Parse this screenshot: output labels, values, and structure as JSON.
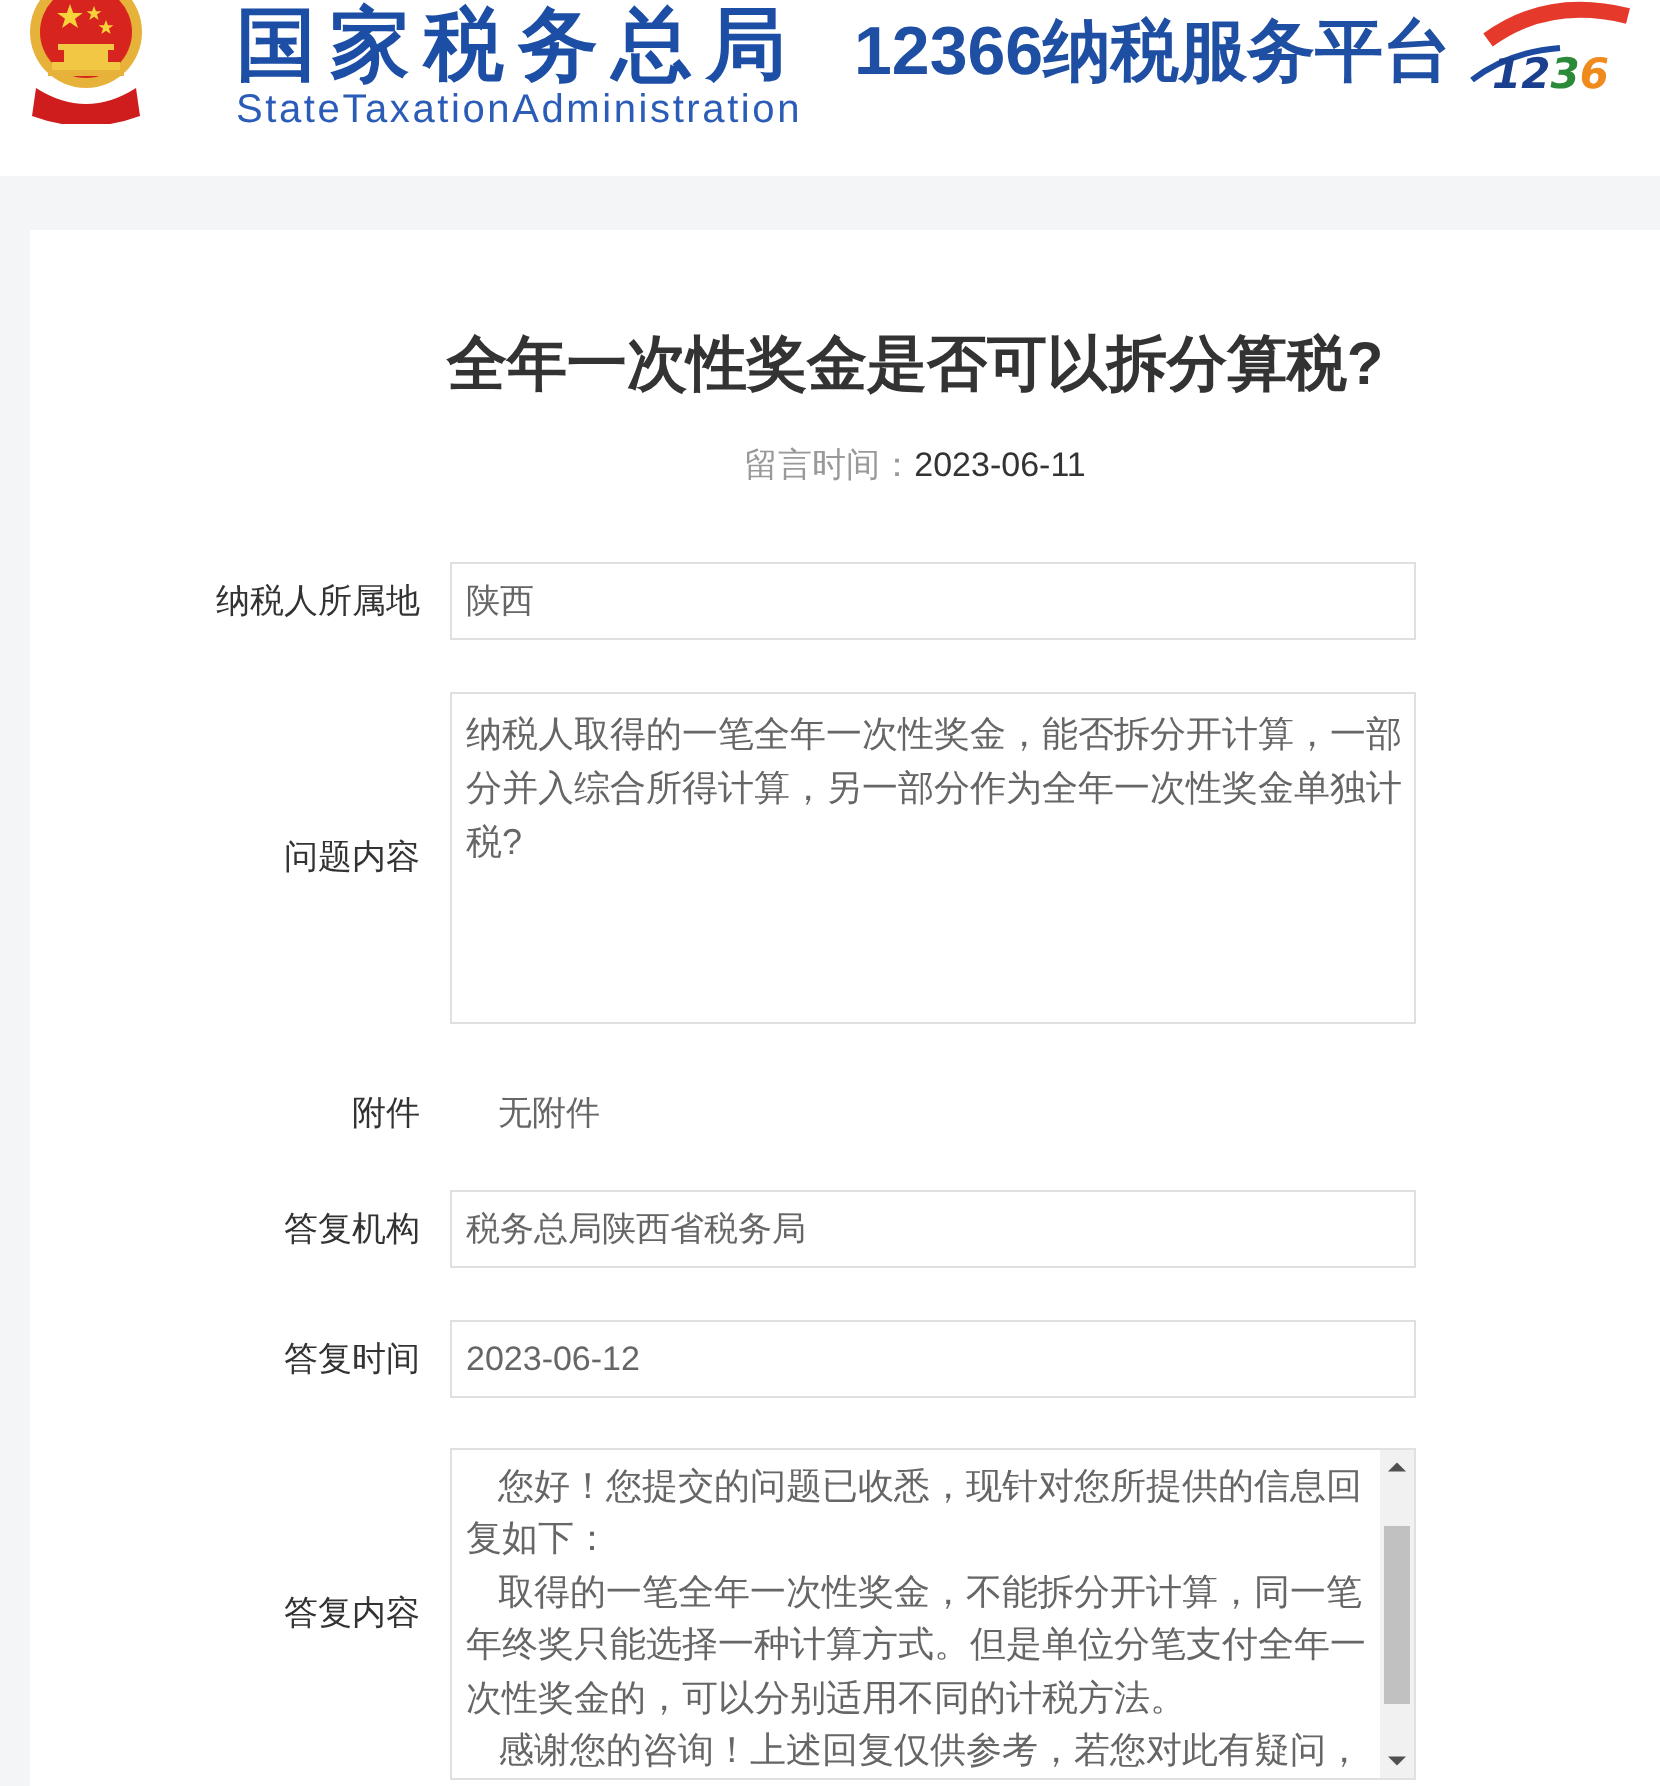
{
  "header": {
    "agency_name": "国家税务总局",
    "agency_name_en": "StateTaxationAdministration",
    "platform_name": "12366纳税服务平台",
    "hotline_logo_text": "1236"
  },
  "article": {
    "title": "全年一次性奖金是否可以拆分算税?",
    "posted_label": "留言时间：",
    "posted_date": "2023-06-11"
  },
  "fields": [
    {
      "kind": "input",
      "label": "纳税人所属地",
      "value": "陕西"
    },
    {
      "kind": "textarea",
      "label": "问题内容",
      "paragraphs": [
        "纳税人取得的一笔全年一次性奖金，能否拆分开计算，一部分并入综合所得计算，另一部分作为全年一次性奖金单独计税?"
      ]
    },
    {
      "kind": "text",
      "label": "附件",
      "value": "无附件"
    },
    {
      "kind": "input",
      "label": "答复机构",
      "value": "税务总局陕西省税务局"
    },
    {
      "kind": "input",
      "label": "答复时间",
      "value": "2023-06-12"
    },
    {
      "kind": "scrollbox",
      "label": "答复内容",
      "paragraphs": [
        "您好！您提交的问题已收悉，现针对您所提供的信息回复如下：",
        "取得的一笔全年一次性奖金，不能拆分开计算，同一笔年终奖只能选择一种计算方式。但是单位分笔支付全年一次性奖金的，可以分别适用不同的计税方法。",
        "感谢您的咨询！上述回复仅供参考，若您对此有疑问，"
      ]
    }
  ]
}
